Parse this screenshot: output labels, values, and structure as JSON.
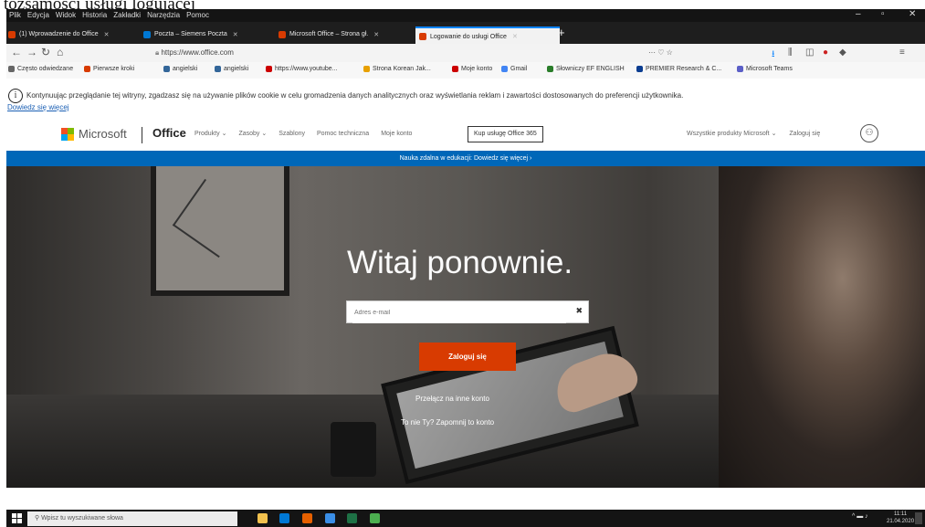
{
  "caption": "tożsamości usługi logującej",
  "browser": {
    "menu": [
      "Plik",
      "Edycja",
      "Widok",
      "Historia",
      "Zakładki",
      "Narzędzia",
      "Pomoc"
    ],
    "window_controls": {
      "minimize": "–",
      "maximize": "▫",
      "close": "✕"
    },
    "tabs": [
      {
        "label": "(1) Wprowadzenie do Office",
        "favicon_color": "#d83b01",
        "active": false
      },
      {
        "label": "Poczta – Siemens Poczta",
        "favicon_color": "#0078d4",
        "active": false
      },
      {
        "label": "Microsoft Office – Strona gł.",
        "favicon_color": "#d83b01",
        "active": false
      },
      {
        "label": "Logowanie do usługi Office",
        "favicon_color": "#d83b01",
        "active": true
      }
    ],
    "newtab": "+",
    "nav": {
      "back": "←",
      "forward": "→",
      "reload": "↻",
      "home": "⌂"
    },
    "url": "https://www.office.com",
    "url_actions": "··· ♡ ☆",
    "bookmarks": [
      {
        "label": "Często odwiedzane",
        "color": "#666666"
      },
      {
        "label": "Pierwsze kroki",
        "color": "#d83b01"
      },
      {
        "label": "angielski",
        "color": "#336699"
      },
      {
        "label": "angielski",
        "color": "#336699"
      },
      {
        "label": "https://www.youtube...",
        "color": "#cc0000"
      },
      {
        "label": "Strona Korean Jak...",
        "color": "#e8a000"
      },
      {
        "label": "Moje konto",
        "color": "#cc0000"
      },
      {
        "label": "Gmail",
        "color": "#4285f4"
      },
      {
        "label": "Słowniczy EF ENGLISH",
        "color": "#2a7d2a"
      },
      {
        "label": "PREMIER Research & C...",
        "color": "#0b3d91"
      },
      {
        "label": "Microsoft Teams",
        "color": "#5b5fc7"
      }
    ]
  },
  "cookie_bar": {
    "info_icon": "i",
    "text": "Kontynuując przeglądanie tej witryny, zgadzasz się na używanie plików cookie w celu gromadzenia danych analitycznych oraz wyświetlania reklam i zawartości dostosowanych do preferencji użytkownika.",
    "link": "Dowiedz się więcej"
  },
  "ms_header": {
    "brand": "Microsoft",
    "product": "Office",
    "nav_links": [
      "Produkty ⌄",
      "Zasoby ⌄",
      "Szablony",
      "Pomoc techniczna",
      "Moje konto"
    ],
    "buy_button": "Kup usługę Office 365",
    "all_products": "Wszystkie produkty Microsoft ⌄",
    "signin_link": "Zaloguj się",
    "avatar_glyph": "⚇"
  },
  "banner": {
    "text": "Nauka zdalna w edukacji: Dowiedz się więcej ›"
  },
  "hero": {
    "title": "Witaj ponownie.",
    "email_placeholder": "Adres e-mail",
    "clear_glyph": "✖",
    "signin_button": "Zaloguj się",
    "switch_account": "Przełącz na inne konto",
    "not_you": "To nie Ty? Zapomnij to konto"
  },
  "taskbar": {
    "search_placeholder": "Wpisz tu wyszukiwane słowa",
    "apps": [
      {
        "name": "file-explorer",
        "color": "#f2c14e"
      },
      {
        "name": "mail",
        "color": "#0078d4"
      },
      {
        "name": "firefox",
        "color": "#e66000"
      },
      {
        "name": "store",
        "color": "#3a8ee6"
      },
      {
        "name": "excel",
        "color": "#1e7145"
      },
      {
        "name": "chrome",
        "color": "#4caf50"
      }
    ],
    "tray": "^ ▬ ♪",
    "time": "11:11",
    "date": "21.04.2020"
  },
  "colors": {
    "accent": "#0067b8",
    "signin": "#d83b01"
  }
}
